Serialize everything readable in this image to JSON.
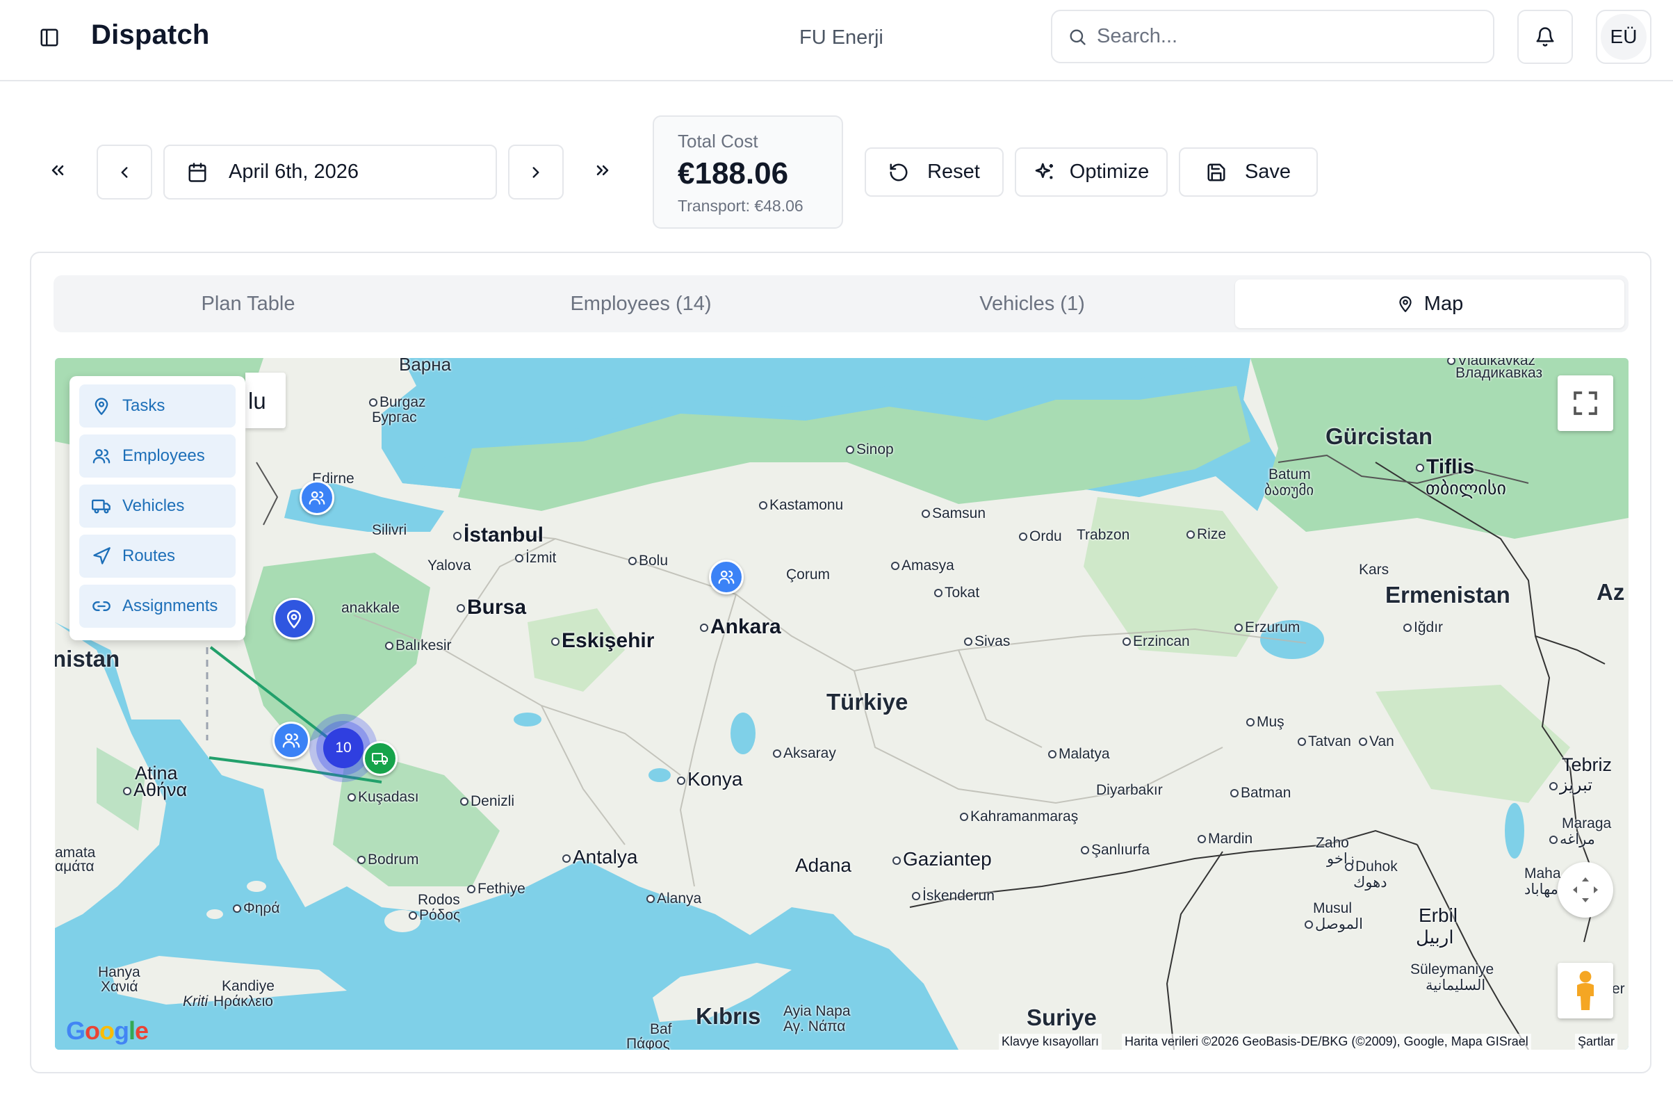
{
  "header": {
    "app_title": "Dispatch",
    "company": "FU Enerji",
    "search_placeholder": "Search...",
    "avatar_initials": "EÜ"
  },
  "toolbar": {
    "date": "April 6th, 2026",
    "total_cost_label": "Total Cost",
    "total_cost_value": "€188.06",
    "transport_cost": "Transport: €48.06",
    "reset_label": "Reset",
    "optimize_label": "Optimize",
    "save_label": "Save"
  },
  "tabs": {
    "plan_table": "Plan Table",
    "employees": "Employees (14)",
    "vehicles": "Vehicles (1)",
    "map": "Map",
    "active": "map"
  },
  "map": {
    "layers": [
      {
        "label": "Tasks",
        "icon": "map-pin-icon"
      },
      {
        "label": "Employees",
        "icon": "users-icon"
      },
      {
        "label": "Vehicles",
        "icon": "truck-icon"
      },
      {
        "label": "Routes",
        "icon": "navigation-icon"
      },
      {
        "label": "Assignments",
        "icon": "link-icon"
      }
    ],
    "map_type_partial": "lu",
    "cluster_count": "10",
    "labels": {
      "varna": "Варна",
      "burgaz": "Burgaz",
      "burgas": "Бургас",
      "edirne": "Edirne",
      "silivri": "Silivri",
      "istanbul": "İstanbul",
      "izmit": "İzmit",
      "yalova": "Yalova",
      "bolu": "Bolu",
      "bursa": "Bursa",
      "canakkale": "anakkale",
      "balikesir": "Balıkesir",
      "eskisehir": "Eskişehir",
      "ankara": "Ankara",
      "kastamonu": "Kastamonu",
      "sinop": "Sinop",
      "samsun": "Samsun",
      "corum": "Çorum",
      "amasya": "Amasya",
      "tokat": "Tokat",
      "ordu": "Ordu",
      "trabzon": "Trabzon",
      "rize": "Rize",
      "sivas": "Sivas",
      "erzincan": "Erzincan",
      "erzurum": "Erzurum",
      "kars": "Kars",
      "igdir": "Iğdır",
      "batum": "Batum",
      "batumi_ka": "ბათუმი",
      "tiflis": "Tiflis",
      "tbilisi_ka": "თბილისი",
      "vladikavkaz": "Vladikavkaz",
      "vladikavkaz_ru": "Владикавказ",
      "gurcistan": "Gürcistan",
      "ermenistan": "Ermenistan",
      "az": "Az",
      "yunanistan": "nistan",
      "atina": "Atina",
      "athina": "Αθήνα",
      "turkiye": "Türkiye",
      "aksaray": "Aksaray",
      "konya": "Konya",
      "denizli": "Denizli",
      "kusadasi": "Kuşadası",
      "bodrum": "Bodrum",
      "fethiye": "Fethiye",
      "antalya": "Antalya",
      "alanya": "Alanya",
      "rodos": "Rodos",
      "rodos_gr": "Ρόδος",
      "fira": "Φηρά",
      "lamata": "amata",
      "lamata_gr": "αμάτα",
      "hanya": "Hanya",
      "hanya_gr": "Χανιά",
      "kandiye": "Kandiye",
      "kandiye_gr": "Ηράκλειο",
      "kriti": "Kriti",
      "adana": "Adana",
      "gaziantep": "Gaziantep",
      "iskenderun": "İskenderun",
      "kahramanmaras": "Kahramanmaraş",
      "malatya": "Malatya",
      "diyarbakir": "Diyarbakır",
      "sanliurfa": "Şanlıurfa",
      "mardin": "Mardin",
      "batman": "Batman",
      "mus": "Muş",
      "tatvan": "Tatvan",
      "van": "Van",
      "tebriz": "Tebriz",
      "tebriz_fa": "تبریز",
      "maraga": "Maraga",
      "maraga_fa": "مراغه",
      "mahabad": "Maha",
      "mahabad_fa": "مهاباد",
      "zaho": "Zaho",
      "zaho_ar": "زاخو",
      "duhok": "Duhok",
      "duhok_ar": "دهوك",
      "musul": "Musul",
      "musul_ar": "الموصل",
      "erbil": "Erbil",
      "erbil_ar": "اربيل",
      "suleymaniye": "Süleymaniye",
      "suleymaniye_ar": "السليمانية",
      "suriye": "Suriye",
      "kibris": "Kıbrıs",
      "ayia_napa": "Ayia Napa",
      "ayia_napa_gr": "Αγ. Νάπα",
      "baf": "Baf",
      "baf_gr": "Πάφος",
      "er": "er"
    },
    "attribution": {
      "keyboard": "Klavye kısayolları",
      "data": "Harita verileri ©2026 GeoBasis-DE/BKG (©2009), Google, Mapa GISrael",
      "terms": "Şartlar"
    },
    "google": [
      "G",
      "o",
      "o",
      "g",
      "l",
      "e"
    ],
    "colors": {
      "sea": "#7fd0e8",
      "land": "#eef0ea",
      "green": "#a8dcb3",
      "marker_blue": "#3b82f6",
      "route_green": "#22a06b",
      "vehicle_green": "#16a34a"
    }
  }
}
